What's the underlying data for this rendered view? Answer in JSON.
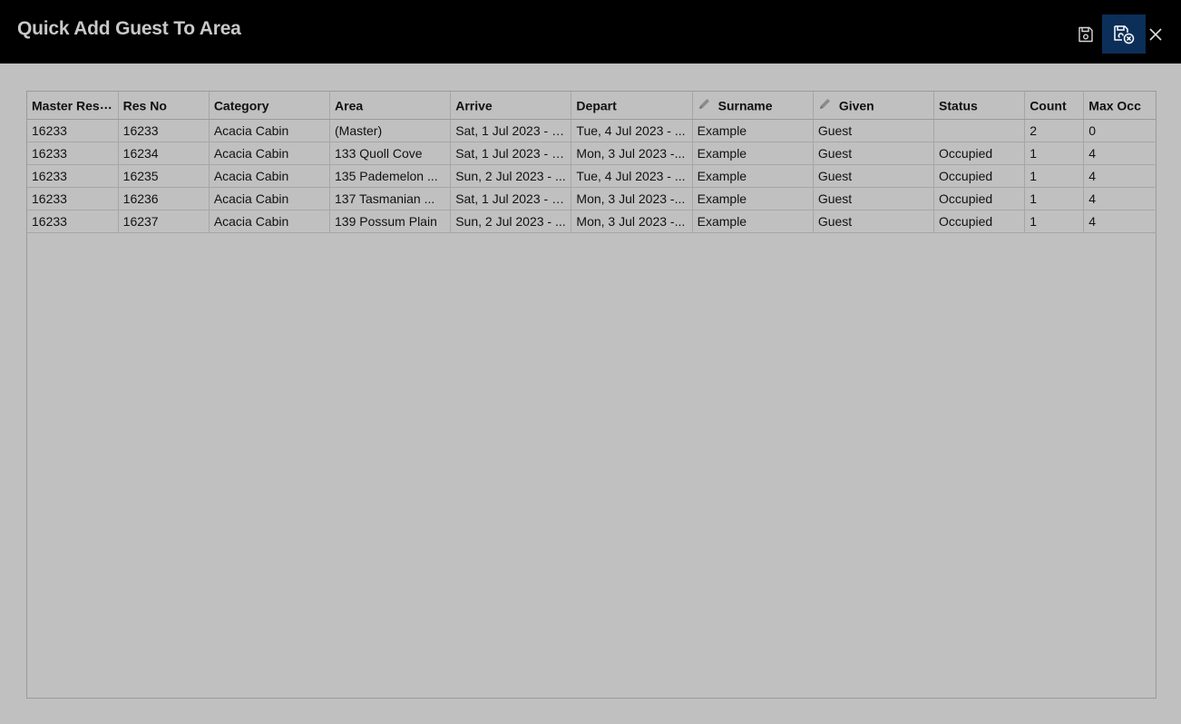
{
  "window": {
    "title": "Quick Add Guest To Area"
  },
  "toolbar": {
    "save_icon": "save-icon",
    "save_close_icon": "save-close-icon",
    "close_icon": "close-icon",
    "active_color": "#0b2f58"
  },
  "table": {
    "columns": [
      {
        "label": "Master Res ...",
        "editable": false
      },
      {
        "label": "Res No",
        "editable": false
      },
      {
        "label": "Category",
        "editable": false
      },
      {
        "label": "Area",
        "editable": false
      },
      {
        "label": "Arrive",
        "editable": false
      },
      {
        "label": "Depart",
        "editable": false
      },
      {
        "label": "Surname",
        "editable": true
      },
      {
        "label": "Given",
        "editable": true
      },
      {
        "label": "Status",
        "editable": false
      },
      {
        "label": "Count",
        "editable": false
      },
      {
        "label": "Max Occ",
        "editable": false
      }
    ],
    "rows": [
      [
        "16233",
        "16233",
        "Acacia Cabin",
        "(Master)",
        "Sat, 1 Jul 2023 - 2...",
        "Tue, 4 Jul 2023 - ...",
        "Example",
        "Guest",
        "",
        "2",
        "0"
      ],
      [
        "16233",
        "16234",
        "Acacia Cabin",
        "133 Quoll Cove",
        "Sat, 1 Jul 2023 - 2...",
        "Mon, 3 Jul 2023 -...",
        "Example",
        "Guest",
        "Occupied",
        "1",
        "4"
      ],
      [
        "16233",
        "16235",
        "Acacia Cabin",
        "135 Pademelon ...",
        "Sun, 2 Jul 2023 - ...",
        "Tue, 4 Jul 2023 - ...",
        "Example",
        "Guest",
        "Occupied",
        "1",
        "4"
      ],
      [
        "16233",
        "16236",
        "Acacia Cabin",
        "137 Tasmanian ...",
        "Sat, 1 Jul 2023 - 2...",
        "Mon, 3 Jul 2023 -...",
        "Example",
        "Guest",
        "Occupied",
        "1",
        "4"
      ],
      [
        "16233",
        "16237",
        "Acacia Cabin",
        "139 Possum Plain",
        "Sun, 2 Jul 2023 - ...",
        "Mon, 3 Jul 2023 -...",
        "Example",
        "Guest",
        "Occupied",
        "1",
        "4"
      ]
    ]
  }
}
